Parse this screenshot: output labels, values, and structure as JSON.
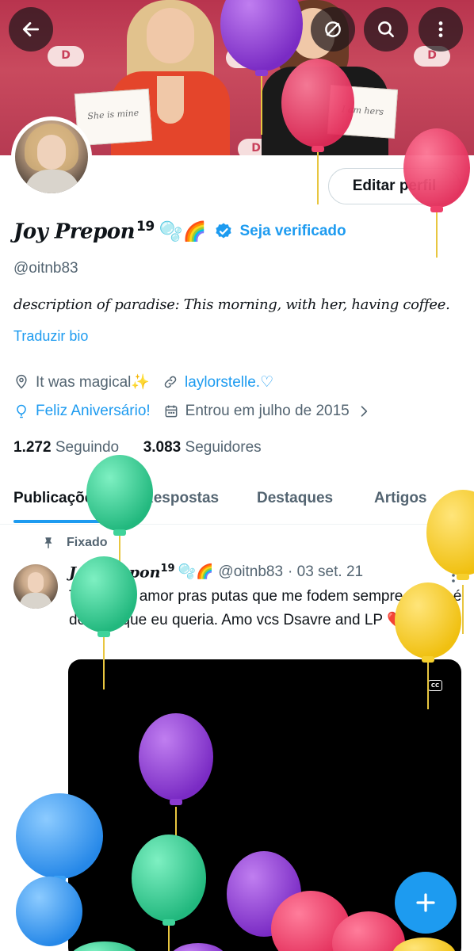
{
  "header": {
    "back_icon": "arrow-left-icon",
    "buttons": [
      "no-sensitive-icon",
      "search-icon",
      "more-vertical-icon"
    ]
  },
  "banner": {
    "sign1": "She is mine",
    "sign2": "I am hers"
  },
  "profile": {
    "edit_button": "Editar perfil",
    "name": "Joy Prepon",
    "name_sup": "19",
    "name_emojis": "🫧🌈",
    "get_verified": "Seja verificado",
    "handle": "@oitnb83",
    "bio_italic": "description of paradise",
    "bio_rest": ": This morning, with her, having coffee.",
    "translate": "Traduzir bio",
    "location": "It was magical✨",
    "website": "laylorstelle.♡",
    "birthday": "Feliz Aniversário!",
    "joined": "Entrou em julho de 2015",
    "following_count": "1.272",
    "following_label": "Seguindo",
    "followers_count": "3.083",
    "followers_label": "Seguidores"
  },
  "tabs": [
    {
      "label": "Publicações"
    },
    {
      "label": "Respostas"
    },
    {
      "label": "Destaques"
    },
    {
      "label": "Artigos"
    }
  ],
  "post": {
    "pinned_label": "Fixado",
    "author_name": "Joy Prepon",
    "author_sup": "19",
    "author_emojis": "🫧🌈",
    "author_handle": "@oitnb83",
    "date": "· 03 set. 21",
    "text": "Todo meu amor pras putas que me fodem sempre e nem é do jeito que eu queria. Amo vcs Dsavre and LP ❤️😍",
    "cc_label": "CC"
  },
  "colors": {
    "accent": "#1d9bf0",
    "secondary_text": "#536471",
    "balloon_purple": "#8b3bd1",
    "balloon_pink": "#ef3f6a",
    "balloon_green": "#3fd39a",
    "balloon_yellow": "#f6cf2e",
    "balloon_blue": "#3aa0f5"
  }
}
